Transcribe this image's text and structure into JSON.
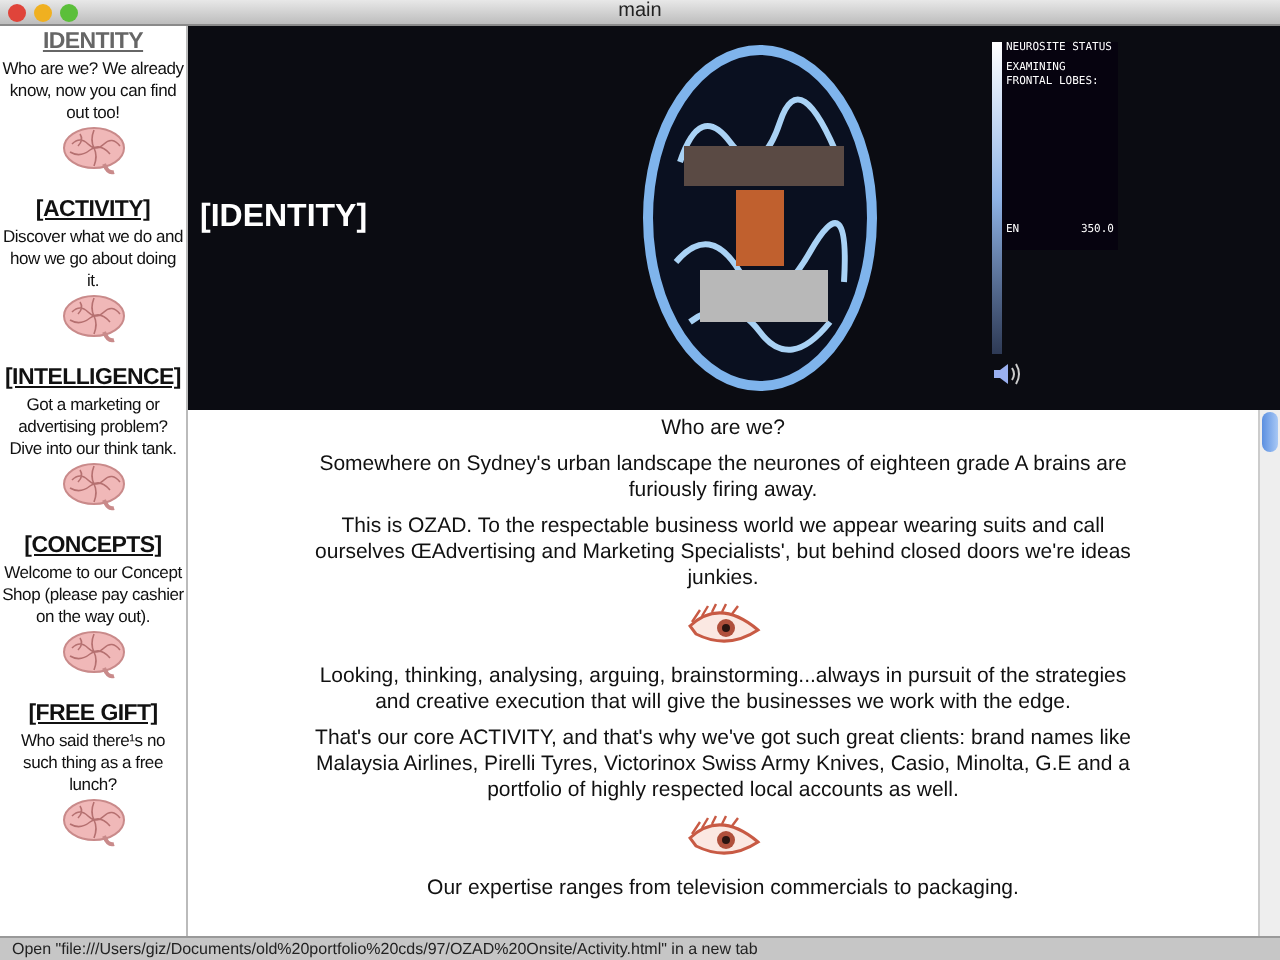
{
  "window": {
    "title": "main"
  },
  "sidebar": {
    "items": [
      {
        "heading": "IDENTITY",
        "selected": true,
        "description": "Who are we? We already know, now you can find out too!"
      },
      {
        "heading": "[ACTIVITY]",
        "selected": false,
        "description": "Discover what we do and how we go about doing it."
      },
      {
        "heading": "[INTELLIGENCE]",
        "selected": false,
        "description": "Got a marketing or advertising problem? Dive into our think tank."
      },
      {
        "heading": "[CONCEPTS]",
        "selected": false,
        "description": "Welcome to our Concept Shop (please pay cashier on the way out)."
      },
      {
        "heading": "[FREE GIFT]",
        "selected": false,
        "description": "Who said there¹s no such thing as a free lunch?"
      }
    ]
  },
  "header": {
    "title": "[IDENTITY]",
    "status_panel": {
      "title": "NEUROSITE STATUS",
      "lines": [
        "EXAMINING",
        "FRONTAL LOBES:"
      ],
      "label": "EN",
      "value": "350.0"
    }
  },
  "content": [
    {
      "kind": "text",
      "text": "Who are we?"
    },
    {
      "kind": "text",
      "text": "Somewhere on Sydney's urban landscape the neurones of eighteen grade A brains are furiously firing away."
    },
    {
      "kind": "text",
      "text": "This is OZAD. To the respectable business world we appear wearing suits and call ourselves ŒAdvertising and Marketing Specialists', but behind closed doors we're ideas junkies."
    },
    {
      "kind": "eye"
    },
    {
      "kind": "text",
      "text": "Looking, thinking, analysing, arguing, brainstorming...always in pursuit of the strategies and creative execution that will give the businesses we work with the edge."
    },
    {
      "kind": "text",
      "text": "That's our core ACTIVITY, and that's why we've got such great clients: brand names like Malaysia Airlines, Pirelli Tyres, Victorinox Swiss Army Knives, Casio, Minolta, G.E and a portfolio of highly respected local accounts as well."
    },
    {
      "kind": "eye"
    },
    {
      "kind": "text",
      "text": "Our expertise ranges from television commercials to packaging."
    }
  ],
  "status_bar": {
    "text": "Open \"file:///Users/giz/Documents/old%20portfolio%20cds/97/OZAD%20Onsite/Activity.html\" in a new tab"
  }
}
